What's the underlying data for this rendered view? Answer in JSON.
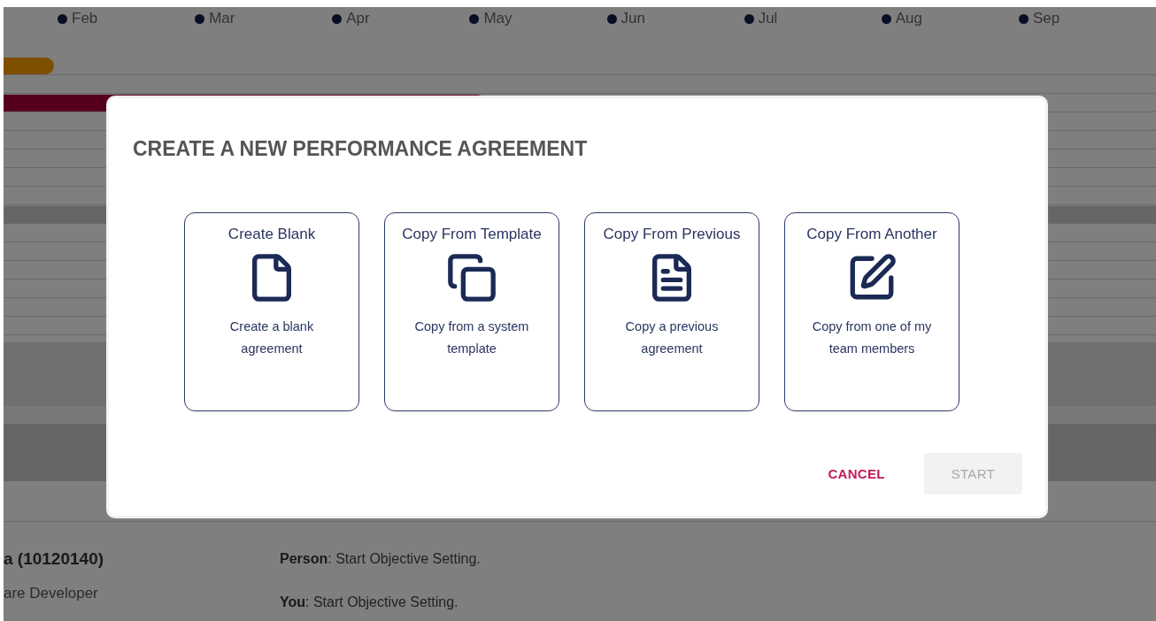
{
  "timeline": {
    "months": [
      "Feb",
      "Mar",
      "Apr",
      "May",
      "Jun",
      "Jul",
      "Aug",
      "Sep"
    ],
    "bars": [
      {
        "color": "#7f4f00"
      },
      {
        "color": "#55001f"
      },
      {
        "color": "#666666"
      }
    ]
  },
  "employee": {
    "name": "a (10120140)",
    "role": "are Developer"
  },
  "actions": [
    "**Person**: Start Objective Setting.",
    "**You**: Start Objective Setting."
  ],
  "dialog": {
    "title": "CREATE A NEW PERFORMANCE AGREEMENT",
    "options": [
      {
        "kind": "blank",
        "title": "Create Blank",
        "description": "Create a blank agreement"
      },
      {
        "kind": "template",
        "title": "Copy From Template",
        "description": "Copy from a system template"
      },
      {
        "kind": "previous",
        "title": "Copy From Previous",
        "description": "Copy a previous agreement"
      },
      {
        "kind": "another",
        "title": "Copy From Another",
        "description": "Copy from one of my team members"
      }
    ],
    "buttons": [
      {
        "kind": "text",
        "label": "CANCEL",
        "disabled": false
      },
      {
        "kind": "contained",
        "label": "START",
        "disabled": true
      }
    ]
  }
}
